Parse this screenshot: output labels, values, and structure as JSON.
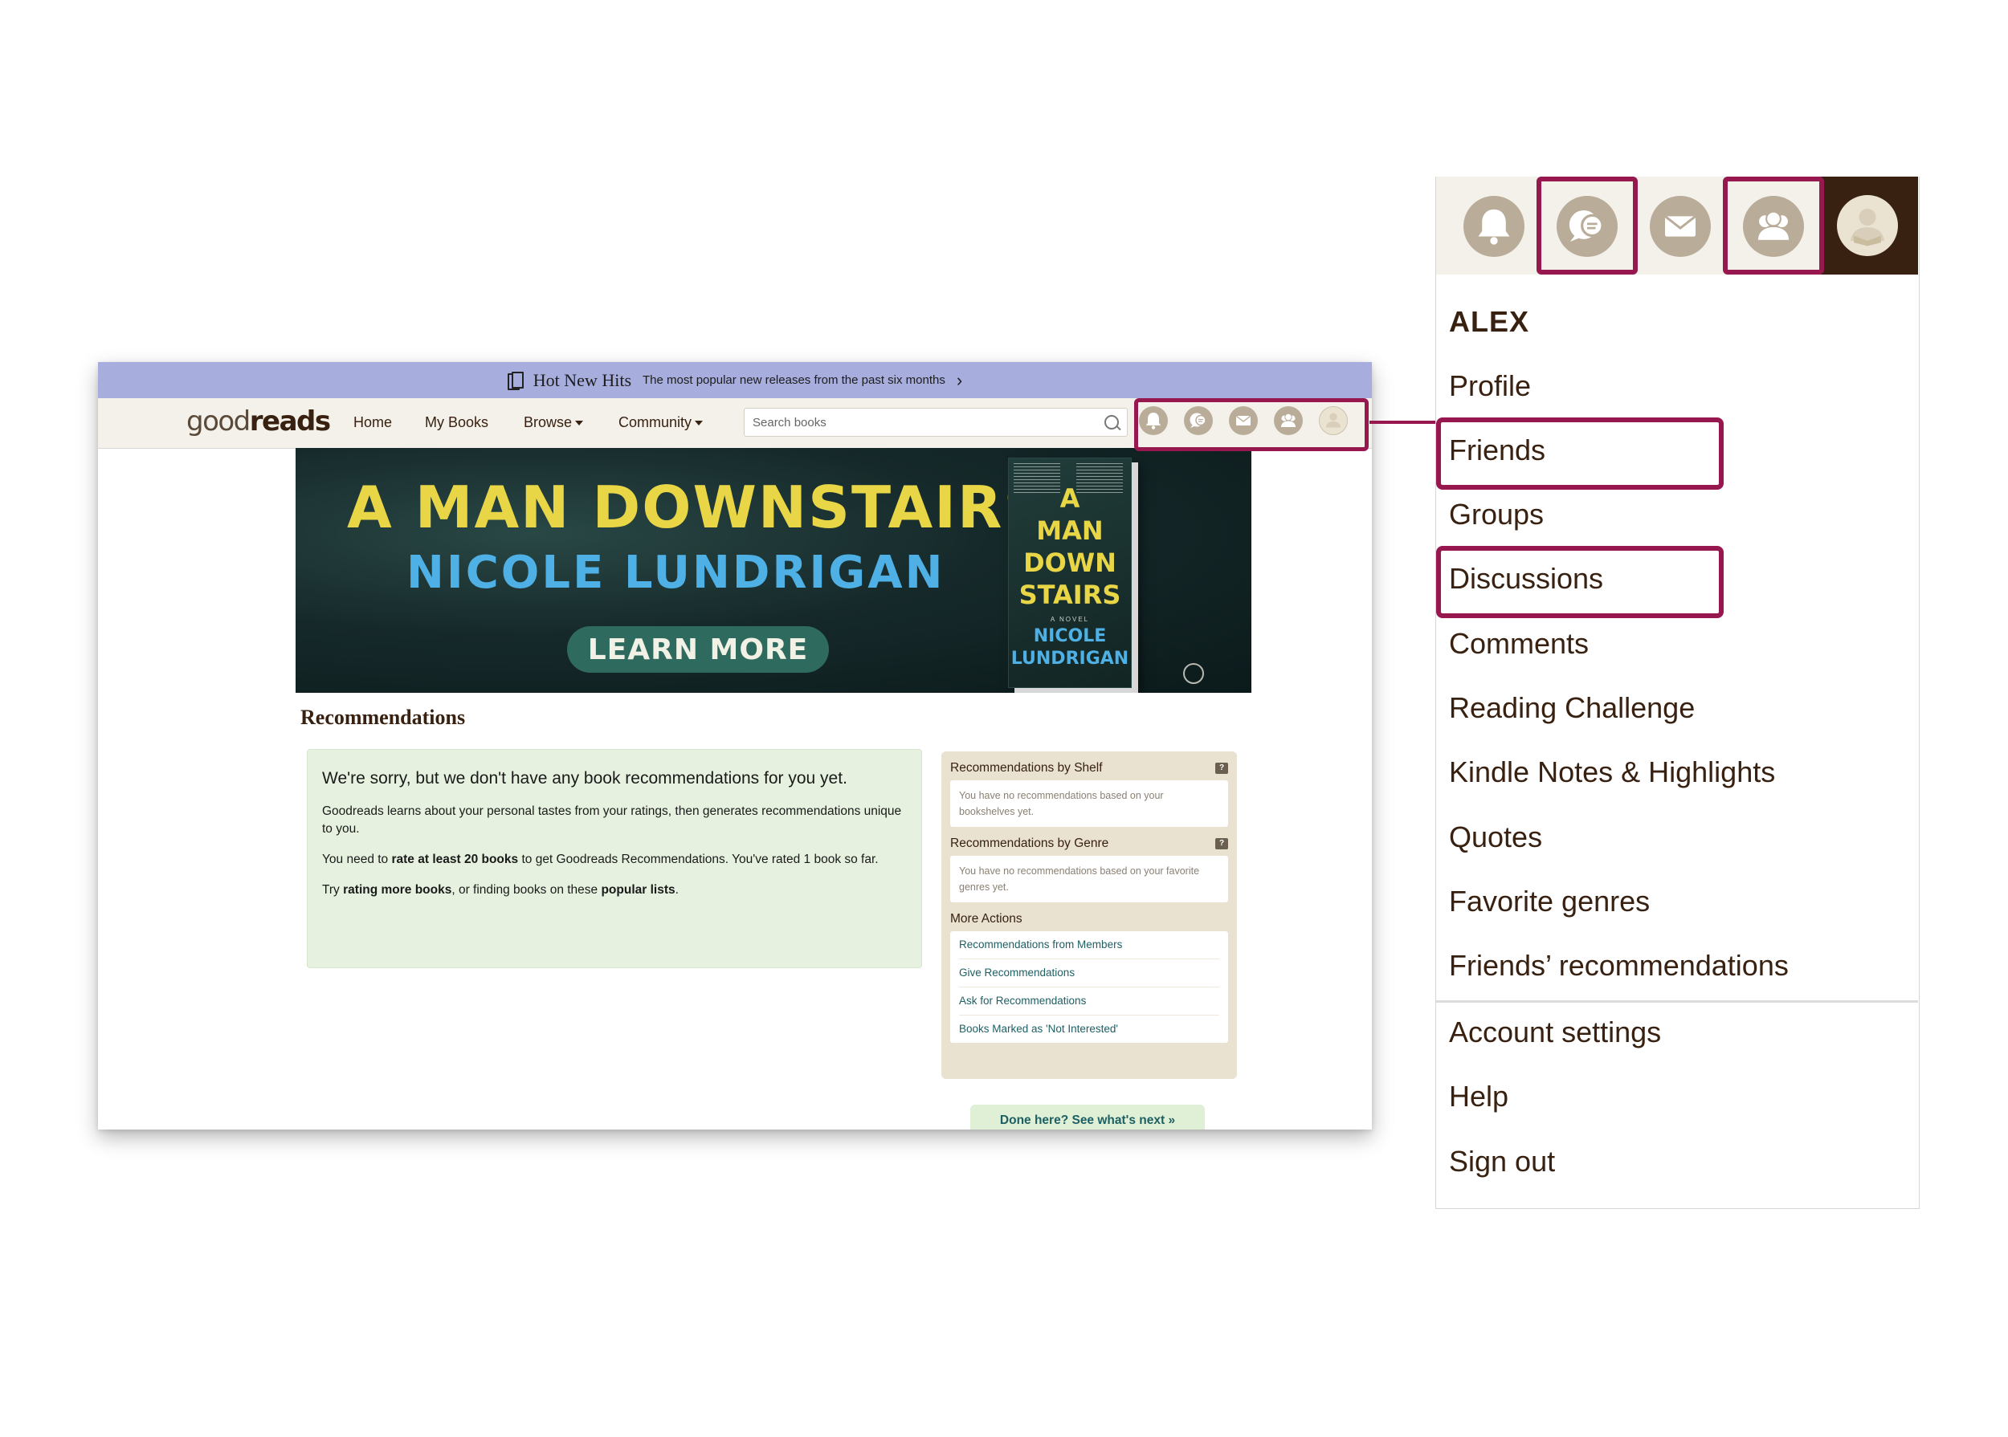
{
  "promo": {
    "title": "Hot New Hits",
    "subtitle": "The most popular new releases from the past six months"
  },
  "nav": {
    "logo_light": "good",
    "logo_dark": "reads",
    "home": "Home",
    "my_books": "My Books",
    "browse": "Browse",
    "community": "Community",
    "search_placeholder": "Search books",
    "icons": [
      "bell-icon",
      "discussion-icon",
      "mail-icon",
      "friends-icon",
      "avatar"
    ]
  },
  "banner": {
    "title": "A MAN DOWNSTAIRS",
    "author": "NICOLE LUNDRIGAN",
    "button": "LEARN MORE",
    "book_title": "A\nMAN\nDOWN\nSTAIRS",
    "book_novel": "A NOVEL",
    "book_author": "NICOLE\nLUNDRIGAN"
  },
  "recommendations": {
    "heading": "Recommendations",
    "sorry_title": "We're sorry, but we don't have any book recommendations for you yet.",
    "p1": "Goodreads learns about your personal tastes from your ratings, then generates recommendations unique to you.",
    "p2_a": "You need to ",
    "p2_b": "rate at least 20 books",
    "p2_c": " to get Goodreads Recommendations. You've rated 1 book so far.",
    "p3_a": "Try ",
    "p3_b": "rating more books",
    "p3_c": ", or finding books on these ",
    "p3_d": "popular lists",
    "p3_e": "."
  },
  "sidebar": {
    "by_shelf": "Recommendations by Shelf",
    "by_shelf_empty": "You have no recommendations based on your bookshelves yet.",
    "by_genre": "Recommendations by Genre",
    "by_genre_empty": "You have no recommendations based on your favorite genres yet.",
    "help_mark": "?",
    "more_actions": "More Actions",
    "actions": [
      "Recommendations from Members",
      "Give Recommendations",
      "Ask for Recommendations",
      "Books Marked as 'Not Interested'"
    ],
    "done": "Done here? See what's next »"
  },
  "panel": {
    "username": "ALEX",
    "items": [
      "Profile",
      "Friends",
      "Groups",
      "Discussions",
      "Comments",
      "Reading Challenge",
      "Kindle Notes & Highlights",
      "Quotes",
      "Favorite genres",
      "Friends’ recommendations"
    ],
    "settings": [
      "Account settings",
      "Help",
      "Sign out"
    ]
  },
  "colors": {
    "highlight": "#97174f",
    "promo_bg": "#a7addd",
    "nav_bg": "#f4f1ea",
    "sorry_bg": "#e6f2df",
    "side_bg": "#e9e2d1"
  }
}
